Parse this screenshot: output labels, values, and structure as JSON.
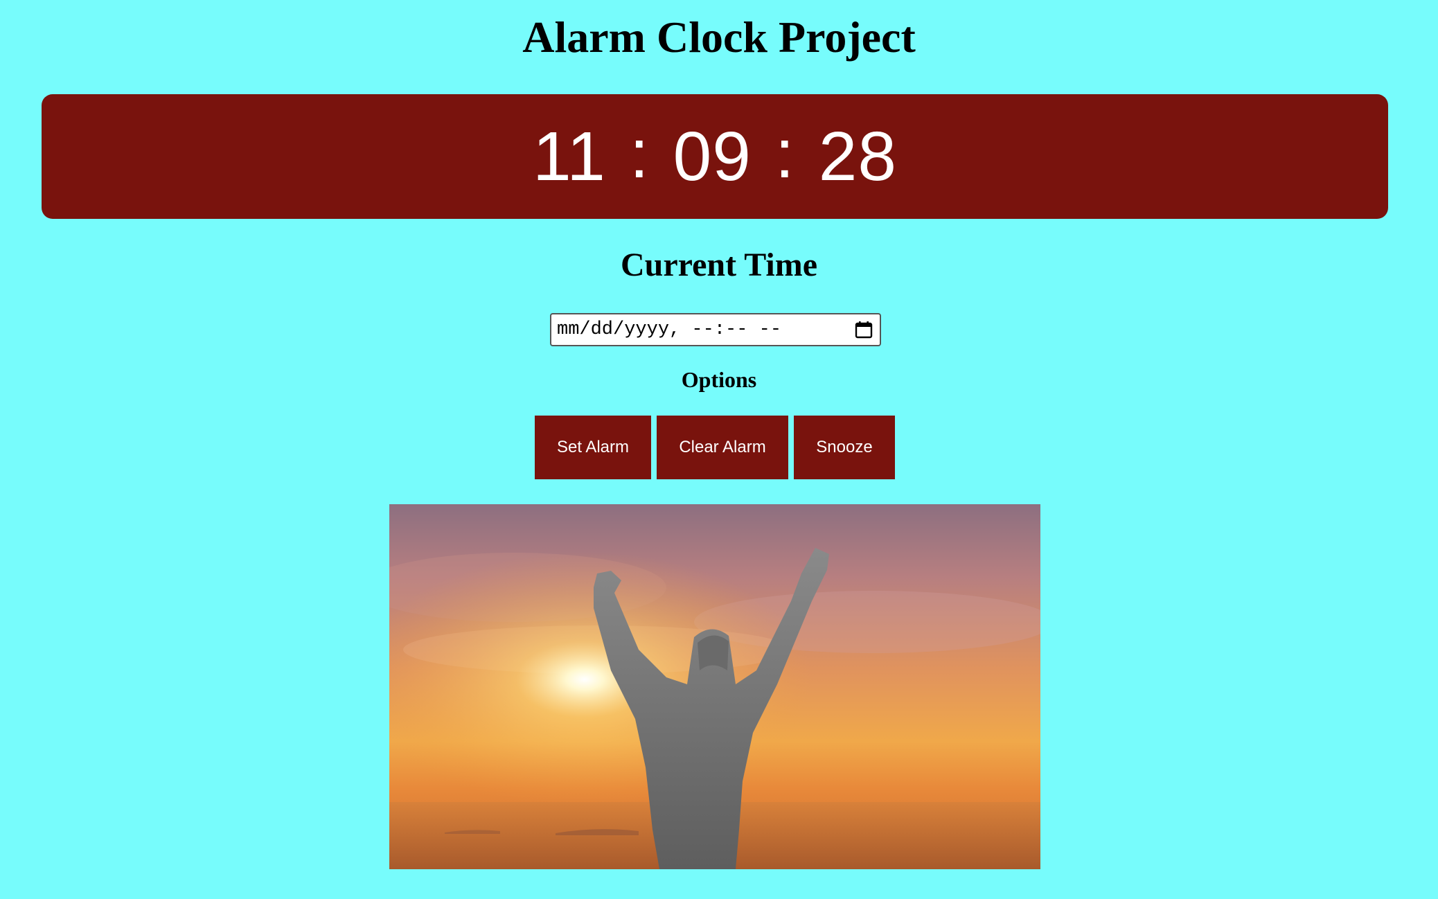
{
  "header": {
    "title": "Alarm Clock Project"
  },
  "clock": {
    "hours": "11",
    "separator": ":",
    "minutes": "09",
    "seconds": "28",
    "panel_color": "#79130d",
    "text_color": "#ffffff"
  },
  "current_time": {
    "heading": "Current Time"
  },
  "alarm_input": {
    "value_placeholder": "mm/dd/yyyy, --:-- --",
    "icon": "calendar-icon"
  },
  "options": {
    "heading": "Options",
    "buttons": [
      {
        "label": "Set Alarm"
      },
      {
        "label": "Clear Alarm"
      },
      {
        "label": "Snooze"
      }
    ],
    "button_color": "#79130d"
  },
  "image": {
    "subject": "person-raising-arms-at-sunrise"
  },
  "theme": {
    "background": "#77fcfc"
  }
}
